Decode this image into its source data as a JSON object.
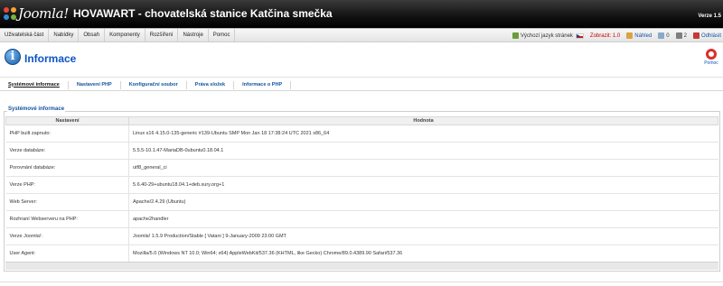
{
  "header": {
    "logo_text": "Joomla!",
    "site_title": "HOVAWART - chovatelská stanice Katčina smečka",
    "version": "Verze 1.5"
  },
  "menu": [
    {
      "label": "Uživatelská část"
    },
    {
      "label": "Nabídky"
    },
    {
      "label": "Obsah"
    },
    {
      "label": "Komponenty"
    },
    {
      "label": "Rozšíření"
    },
    {
      "label": "Nástroje"
    },
    {
      "label": "Pomoc"
    }
  ],
  "status": {
    "language_label": "Výchozí jazyk stránek",
    "messages_label": "Zobrazit: 1.0",
    "preview_label": "Náhled",
    "unread_count": "0",
    "users_count": "2",
    "logout_label": "Odhlásit"
  },
  "toolbar": {
    "title": "Informace",
    "help_label": "Pomoc"
  },
  "tabs": [
    {
      "label": "Systémové informace",
      "active": true
    },
    {
      "label": "Nastavení PHP",
      "active": false
    },
    {
      "label": "Konfigurační soubor",
      "active": false
    },
    {
      "label": "Práva složek",
      "active": false
    },
    {
      "label": "Informace o PHP",
      "active": false
    }
  ],
  "section": {
    "legend": "Systémové informace",
    "col_setting": "Nastavení",
    "col_value": "Hodnota",
    "rows": [
      {
        "key": "PHP built zapnuto:",
        "value": "Linux s16 4.15.0-135-generic #139-Ubuntu SMP Mon Jan 18 17:38:24 UTC 2021 x86_64"
      },
      {
        "key": "Verze databáze:",
        "value": "5.5.5-10.1.47-MariaDB-0ubuntu0.18.04.1"
      },
      {
        "key": "Porovnání databáze:",
        "value": "utf8_general_ci"
      },
      {
        "key": "Verze PHP:",
        "value": "5.6.40-29+ubuntu18.04.1+deb.sury.org+1"
      },
      {
        "key": "Web Server:",
        "value": "Apache/2.4.29 (Ubuntu)"
      },
      {
        "key": "Rozhraní Webserveru na PHP:",
        "value": "apache2handler"
      },
      {
        "key": "Verze Joomla!:",
        "value": "Joomla! 1.5.9 Production/Stable [ Vatani ] 9-January-2009 23:00 GMT"
      },
      {
        "key": "User Agent:",
        "value": "Mozilla/5.0 (Windows NT 10.0; Win64; x64) AppleWebKit/537.36 (KHTML, like Gecko) Chrome/89.0.4389.90 Safari/537.36"
      }
    ]
  }
}
